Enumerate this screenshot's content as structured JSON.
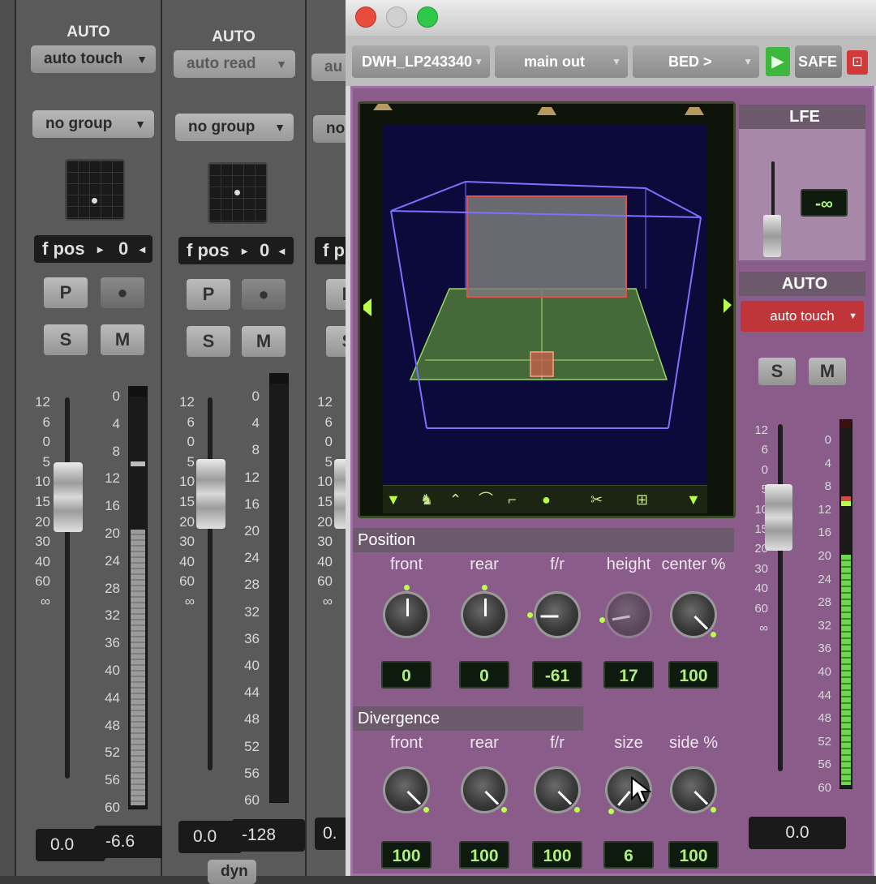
{
  "left_strips": [
    {
      "auto_label": "AUTO",
      "auto_mode": "auto touch",
      "group": "no group",
      "fpos_label": "f pos",
      "fpos_value": "0",
      "rec_buttons": [
        "P",
        "●"
      ],
      "solo": "S",
      "mute": "M",
      "volume": "0.0",
      "peak": "-6.6"
    },
    {
      "auto_label": "AUTO",
      "auto_mode": "auto read",
      "group": "no group",
      "fpos_label": "f pos",
      "fpos_value": "0",
      "rec_buttons": [
        "P",
        "●"
      ],
      "solo": "S",
      "mute": "M",
      "volume": "0.0",
      "peak": "-128",
      "bottom_label": "dyn"
    }
  ],
  "fader_scale": [
    "12",
    "6",
    "0",
    "5",
    "10",
    "15",
    "20",
    "30",
    "40",
    "60",
    "∞"
  ],
  "meter_scale": [
    "0",
    "4",
    "8",
    "12",
    "16",
    "20",
    "24",
    "28",
    "32",
    "36",
    "40",
    "44",
    "48",
    "52",
    "56",
    "60"
  ],
  "partial_strip": {
    "auto_mode": "au",
    "group": "no",
    "fpos": "f p",
    "btn": "P",
    "solo": "S",
    "volume": "0.",
    "scale": [
      "12",
      "6",
      "0",
      "5",
      "10",
      "15",
      "20",
      "30",
      "40",
      "60",
      "∞"
    ]
  },
  "plugin": {
    "track_name": "DWH_LP243340",
    "output": "main out",
    "bed": "BED >",
    "safe": "SAFE",
    "lfe_label": "LFE",
    "lfe_value": "-∞",
    "auto_label": "AUTO",
    "auto_mode": "auto touch",
    "solo": "S",
    "mute": "M",
    "fader_scale": [
      "12",
      "6",
      "0",
      "5",
      "10",
      "15",
      "20",
      "30",
      "40",
      "60",
      "∞"
    ],
    "meter_scale": [
      "0",
      "4",
      "8",
      "12",
      "16",
      "20",
      "24",
      "28",
      "32",
      "36",
      "40",
      "44",
      "48",
      "52",
      "56",
      "60"
    ],
    "volume": "0.0",
    "position": {
      "title": "Position",
      "knobs": [
        {
          "label": "front",
          "value": "0",
          "angle": 0
        },
        {
          "label": "rear",
          "value": "0",
          "angle": 0
        },
        {
          "label": "f/r",
          "value": "-61",
          "angle": -90
        },
        {
          "label": "height",
          "value": "17",
          "angle": -100
        },
        {
          "label": "center %",
          "value": "100",
          "angle": 135
        }
      ]
    },
    "divergence": {
      "title": "Divergence",
      "knobs": [
        {
          "label": "front",
          "value": "100",
          "angle": 135
        },
        {
          "label": "rear",
          "value": "100",
          "angle": 135
        },
        {
          "label": "f/r",
          "value": "100",
          "angle": 135
        },
        {
          "label": "size",
          "value": "6",
          "angle": -140
        },
        {
          "label": "side %",
          "value": "100",
          "angle": 135
        }
      ]
    },
    "colors": {
      "body": "#8a5c8a",
      "auto_red": "#c0353a",
      "lcd_text": "#aef07a",
      "safe_green": "#3cb83c"
    }
  }
}
